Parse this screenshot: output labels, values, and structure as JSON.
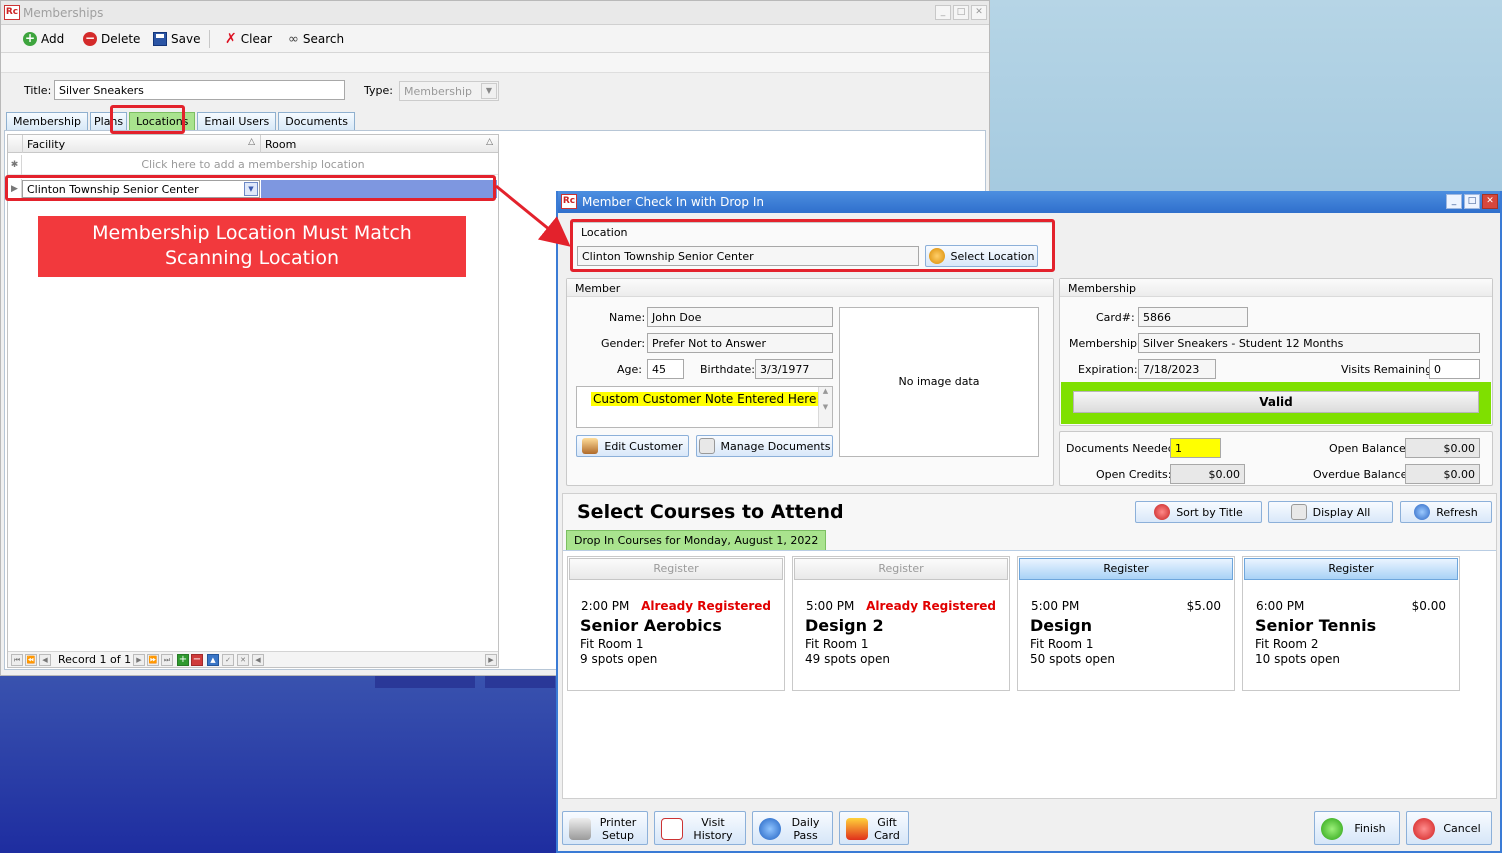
{
  "memberships": {
    "window_title": "Memberships",
    "app_icon": "Rc",
    "toolbar": {
      "add": "Add",
      "delete": "Delete",
      "save": "Save",
      "clear": "Clear",
      "search": "Search"
    },
    "title_label": "Title:",
    "title_value": "Silver Sneakers",
    "type_label": "Type:",
    "type_value": "Membership",
    "tabs": [
      "Membership",
      "Plans",
      "Locations",
      "Email Users",
      "Documents"
    ],
    "active_tab": "Locations",
    "grid": {
      "columns": [
        "Facility",
        "Room"
      ],
      "new_row_hint": "Click here to add a membership location",
      "rows": [
        {
          "facility": "Clinton Township Senior Center",
          "room": ""
        }
      ],
      "nav_text": "Record 1 of 1"
    },
    "annotation": {
      "line1": "Membership Location Must Match",
      "line2": "Scanning Location",
      "color": "#f2393d"
    }
  },
  "checkin": {
    "window_title": "Member Check In with Drop In",
    "location": {
      "group_title": "Location",
      "value": "Clinton Township Senior Center",
      "select_button": "Select Location"
    },
    "member": {
      "group_title": "Member",
      "name_label": "Name:",
      "name": "John Doe",
      "gender_label": "Gender:",
      "gender": "Prefer Not to Answer",
      "age_label": "Age:",
      "age": "45",
      "birthdate_label": "Birthdate:",
      "birthdate": "3/3/1977",
      "note": "Custom Customer Note Entered Here",
      "edit_button": "Edit Customer",
      "docs_button": "Manage Documents",
      "image_placeholder": "No image data"
    },
    "membership": {
      "group_title": "Membership",
      "card_label": "Card#:",
      "card": "5866",
      "membership_label": "Membership:",
      "membership": "Silver Sneakers - Student 12 Months",
      "expiration_label": "Expiration:",
      "expiration": "7/18/2023",
      "visits_label": "Visits Remaining:",
      "visits": "0",
      "status": "Valid",
      "status_color": "#7fe000"
    },
    "balances": {
      "docs_needed_label": "Documents Needed:",
      "docs_needed": "1",
      "open_balance_label": "Open Balance:",
      "open_balance": "$0.00",
      "open_credits_label": "Open Credits:",
      "open_credits": "$0.00",
      "overdue_label": "Overdue Balance:",
      "overdue": "$0.00"
    },
    "courses": {
      "title": "Select Courses to Attend",
      "sort_button": "Sort by Title",
      "display_button": "Display All",
      "refresh_button": "Refresh",
      "day_tab": "Drop In Courses for Monday, August 1, 2022",
      "items": [
        {
          "register": "Register",
          "time": "2:00 PM",
          "status": "Already Registered",
          "price": "",
          "name": "Senior Aerobics",
          "room": "Fit Room 1",
          "spots": "9 spots open",
          "enabled": false
        },
        {
          "register": "Register",
          "time": "5:00 PM",
          "status": "Already Registered",
          "price": "",
          "name": "Design 2",
          "room": "Fit Room 1",
          "spots": "49 spots open",
          "enabled": false
        },
        {
          "register": "Register",
          "time": "5:00 PM",
          "status": "",
          "price": "$5.00",
          "name": "Design",
          "room": "Fit Room 1",
          "spots": "50 spots open",
          "enabled": true
        },
        {
          "register": "Register",
          "time": "6:00 PM",
          "status": "",
          "price": "$0.00",
          "name": "Senior Tennis",
          "room": "Fit Room 2",
          "spots": "10 spots open",
          "enabled": true
        }
      ]
    },
    "bottom": {
      "printer_1": "Printer",
      "printer_2": "Setup",
      "visit_1": "Visit",
      "visit_2": "History",
      "daily_1": "Daily",
      "daily_2": "Pass",
      "gift_1": "Gift",
      "gift_2": "Card",
      "finish": "Finish",
      "cancel": "Cancel"
    }
  },
  "icons": {
    "add": "plus-circle-icon",
    "delete": "minus-circle-icon",
    "save": "floppy-icon",
    "clear": "x-icon",
    "search": "binoculars-icon"
  }
}
